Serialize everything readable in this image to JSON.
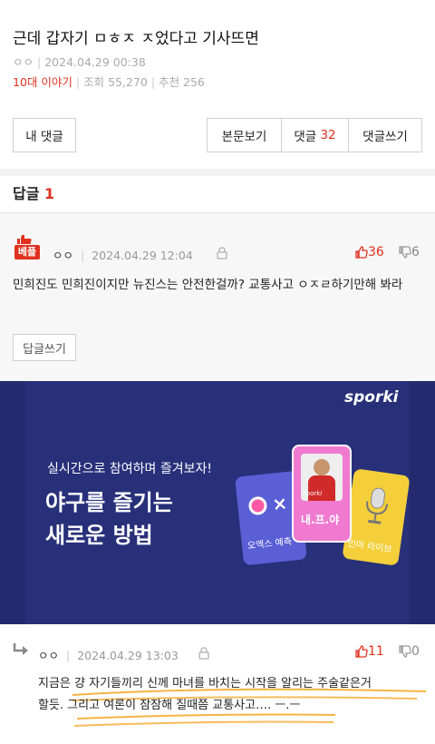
{
  "post": {
    "title": "근데 갑자기 ㅁㅎㅈ ㅈ었다고 기사뜨면",
    "author": "ㅇㅇ",
    "datetime": "2024.04.29 00:38",
    "board": "10대 이야기",
    "views": "조회 55,270",
    "recommend": "추천 256"
  },
  "toolbar": {
    "my_comments": "내 댓글",
    "view_body": "본문보기",
    "comments_label": "댓글",
    "comments_count": "32",
    "write_comment": "댓글쓰기"
  },
  "replies": {
    "label": "답글",
    "count": "1"
  },
  "comment1": {
    "badge": "베플",
    "author": "ㅇㅇ",
    "datetime": "2024.04.29 12:04",
    "up": "36",
    "down": "6",
    "text": "민희진도 민희진이지만 뉴진스는 안전한걸까? 교통사고 ㅇㅈㄹ하기만해 봐라",
    "reply_button": "답글쓰기"
  },
  "banner": {
    "brand": "sporki",
    "tagline": "실시간으로 참여하며 즐겨보자!",
    "headline1": "야구를 즐기는",
    "headline2": "새로운 방법",
    "card1": "오엑스 예측",
    "card2": "내.프.야",
    "card3": "인마 라이브",
    "card_brand": "sporki"
  },
  "comment2": {
    "author": "ㅇㅇ",
    "datetime": "2024.04.29 13:03",
    "up": "11",
    "down": "0",
    "text_line1": "지금은 걍 자기들끼리 신께 마녀를 바치는 시작을 알리는 주술같은거",
    "text_line2": "할듯. 그리고 여론이 잠잠해 질때쯤 교통사고…. ㅡ.ㅡ"
  },
  "colors": {
    "accent": "#e0301e",
    "banner_bg": "#28307a",
    "highlight": "#f5a623"
  }
}
